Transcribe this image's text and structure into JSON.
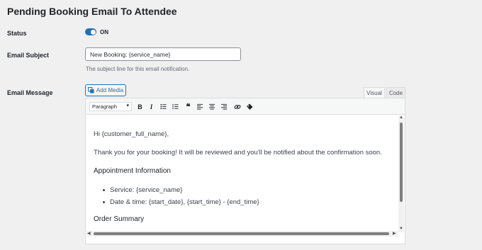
{
  "section": {
    "title": "Pending Booking Email To Attendee"
  },
  "status": {
    "label": "Status",
    "toggle_text": "ON",
    "toggle_state": "on"
  },
  "subject": {
    "label": "Email Subject",
    "value": "New Booking: {service_name}",
    "hint": "The subject line for this email notification."
  },
  "message": {
    "label": "Email Message",
    "add_media": "Add Media",
    "tabs": [
      "Visual",
      "Code"
    ],
    "format_select": "Paragraph",
    "toolbar_icons": [
      "bold-icon",
      "italic-icon",
      "bullet-list-icon",
      "numbered-list-icon",
      "blockquote-icon",
      "align-left-icon",
      "align-center-icon",
      "align-right-icon",
      "link-icon",
      "unlink-icon"
    ],
    "body": {
      "greeting": "Hi {customer_full_name},",
      "thanks": "Thank you for your booking! It will be reviewed and you'll be notified about the confirmation soon.",
      "heading1": "Appointment Information",
      "items": [
        "Service: {service_name}",
        "Date & time: {start_date}, {start_time} - {end_time}"
      ],
      "heading2": "Order Summary"
    }
  },
  "colors": {
    "accent": "#2271b1",
    "background": "#f0f0f1"
  }
}
